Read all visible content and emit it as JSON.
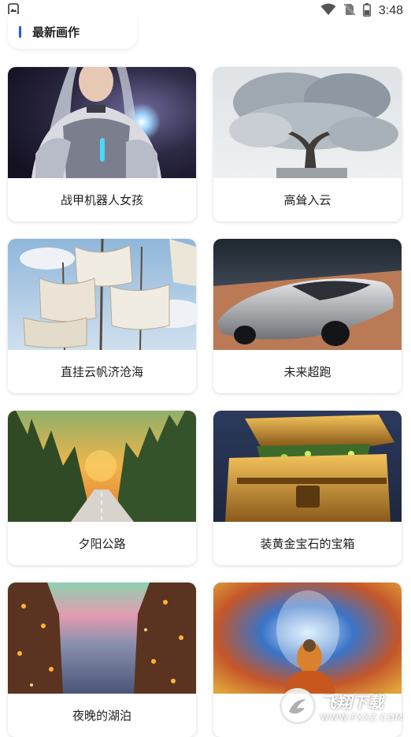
{
  "status_bar": {
    "time": "3:48",
    "icons": [
      "image-notification-icon",
      "wifi-icon",
      "no-sim-icon",
      "battery-icon"
    ]
  },
  "header": {
    "title": "最新画作",
    "accent_color": "#2a5bd7"
  },
  "gallery": [
    {
      "label": "战甲机器人女孩",
      "image": "armored-robot-girl"
    },
    {
      "label": "高耸入云",
      "image": "towering-tree-clouds"
    },
    {
      "label": "直挂云帆济沧海",
      "image": "sailing-ship"
    },
    {
      "label": "未来超跑",
      "image": "futuristic-supercar"
    },
    {
      "label": "夕阳公路",
      "image": "sunset-forest-road"
    },
    {
      "label": "装黄金宝石的宝箱",
      "image": "golden-treasure-chest"
    },
    {
      "label": "夜晚的湖泊",
      "image": "night-lake-lights"
    },
    {
      "label": "",
      "image": "glowing-buddha"
    }
  ],
  "watermark": {
    "main": "飞翔下载",
    "sub": "WWW.FXXZ.COM"
  }
}
